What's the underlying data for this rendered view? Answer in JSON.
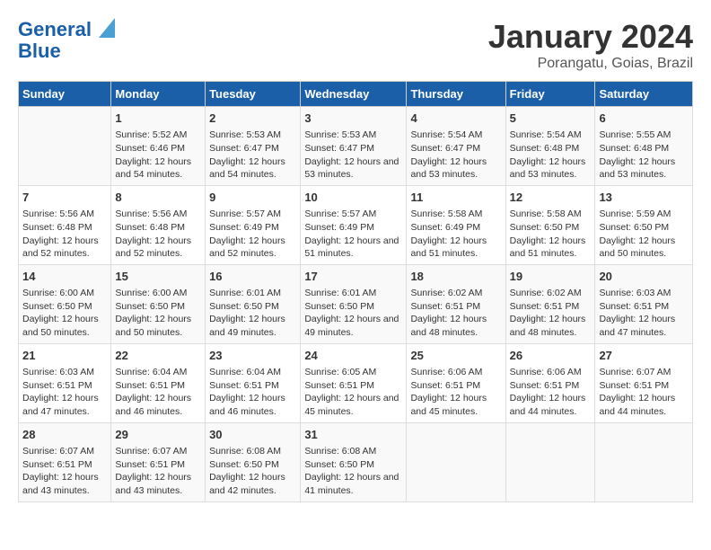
{
  "header": {
    "logo_line1": "General",
    "logo_line2": "Blue",
    "title": "January 2024",
    "subtitle": "Porangatu, Goias, Brazil"
  },
  "weekdays": [
    "Sunday",
    "Monday",
    "Tuesday",
    "Wednesday",
    "Thursday",
    "Friday",
    "Saturday"
  ],
  "weeks": [
    [
      {
        "day": "",
        "sunrise": "",
        "sunset": "",
        "daylight": ""
      },
      {
        "day": "1",
        "sunrise": "Sunrise: 5:52 AM",
        "sunset": "Sunset: 6:46 PM",
        "daylight": "Daylight: 12 hours and 54 minutes."
      },
      {
        "day": "2",
        "sunrise": "Sunrise: 5:53 AM",
        "sunset": "Sunset: 6:47 PM",
        "daylight": "Daylight: 12 hours and 54 minutes."
      },
      {
        "day": "3",
        "sunrise": "Sunrise: 5:53 AM",
        "sunset": "Sunset: 6:47 PM",
        "daylight": "Daylight: 12 hours and 53 minutes."
      },
      {
        "day": "4",
        "sunrise": "Sunrise: 5:54 AM",
        "sunset": "Sunset: 6:47 PM",
        "daylight": "Daylight: 12 hours and 53 minutes."
      },
      {
        "day": "5",
        "sunrise": "Sunrise: 5:54 AM",
        "sunset": "Sunset: 6:48 PM",
        "daylight": "Daylight: 12 hours and 53 minutes."
      },
      {
        "day": "6",
        "sunrise": "Sunrise: 5:55 AM",
        "sunset": "Sunset: 6:48 PM",
        "daylight": "Daylight: 12 hours and 53 minutes."
      }
    ],
    [
      {
        "day": "7",
        "sunrise": "Sunrise: 5:56 AM",
        "sunset": "Sunset: 6:48 PM",
        "daylight": "Daylight: 12 hours and 52 minutes."
      },
      {
        "day": "8",
        "sunrise": "Sunrise: 5:56 AM",
        "sunset": "Sunset: 6:48 PM",
        "daylight": "Daylight: 12 hours and 52 minutes."
      },
      {
        "day": "9",
        "sunrise": "Sunrise: 5:57 AM",
        "sunset": "Sunset: 6:49 PM",
        "daylight": "Daylight: 12 hours and 52 minutes."
      },
      {
        "day": "10",
        "sunrise": "Sunrise: 5:57 AM",
        "sunset": "Sunset: 6:49 PM",
        "daylight": "Daylight: 12 hours and 51 minutes."
      },
      {
        "day": "11",
        "sunrise": "Sunrise: 5:58 AM",
        "sunset": "Sunset: 6:49 PM",
        "daylight": "Daylight: 12 hours and 51 minutes."
      },
      {
        "day": "12",
        "sunrise": "Sunrise: 5:58 AM",
        "sunset": "Sunset: 6:50 PM",
        "daylight": "Daylight: 12 hours and 51 minutes."
      },
      {
        "day": "13",
        "sunrise": "Sunrise: 5:59 AM",
        "sunset": "Sunset: 6:50 PM",
        "daylight": "Daylight: 12 hours and 50 minutes."
      }
    ],
    [
      {
        "day": "14",
        "sunrise": "Sunrise: 6:00 AM",
        "sunset": "Sunset: 6:50 PM",
        "daylight": "Daylight: 12 hours and 50 minutes."
      },
      {
        "day": "15",
        "sunrise": "Sunrise: 6:00 AM",
        "sunset": "Sunset: 6:50 PM",
        "daylight": "Daylight: 12 hours and 50 minutes."
      },
      {
        "day": "16",
        "sunrise": "Sunrise: 6:01 AM",
        "sunset": "Sunset: 6:50 PM",
        "daylight": "Daylight: 12 hours and 49 minutes."
      },
      {
        "day": "17",
        "sunrise": "Sunrise: 6:01 AM",
        "sunset": "Sunset: 6:50 PM",
        "daylight": "Daylight: 12 hours and 49 minutes."
      },
      {
        "day": "18",
        "sunrise": "Sunrise: 6:02 AM",
        "sunset": "Sunset: 6:51 PM",
        "daylight": "Daylight: 12 hours and 48 minutes."
      },
      {
        "day": "19",
        "sunrise": "Sunrise: 6:02 AM",
        "sunset": "Sunset: 6:51 PM",
        "daylight": "Daylight: 12 hours and 48 minutes."
      },
      {
        "day": "20",
        "sunrise": "Sunrise: 6:03 AM",
        "sunset": "Sunset: 6:51 PM",
        "daylight": "Daylight: 12 hours and 47 minutes."
      }
    ],
    [
      {
        "day": "21",
        "sunrise": "Sunrise: 6:03 AM",
        "sunset": "Sunset: 6:51 PM",
        "daylight": "Daylight: 12 hours and 47 minutes."
      },
      {
        "day": "22",
        "sunrise": "Sunrise: 6:04 AM",
        "sunset": "Sunset: 6:51 PM",
        "daylight": "Daylight: 12 hours and 46 minutes."
      },
      {
        "day": "23",
        "sunrise": "Sunrise: 6:04 AM",
        "sunset": "Sunset: 6:51 PM",
        "daylight": "Daylight: 12 hours and 46 minutes."
      },
      {
        "day": "24",
        "sunrise": "Sunrise: 6:05 AM",
        "sunset": "Sunset: 6:51 PM",
        "daylight": "Daylight: 12 hours and 45 minutes."
      },
      {
        "day": "25",
        "sunrise": "Sunrise: 6:06 AM",
        "sunset": "Sunset: 6:51 PM",
        "daylight": "Daylight: 12 hours and 45 minutes."
      },
      {
        "day": "26",
        "sunrise": "Sunrise: 6:06 AM",
        "sunset": "Sunset: 6:51 PM",
        "daylight": "Daylight: 12 hours and 44 minutes."
      },
      {
        "day": "27",
        "sunrise": "Sunrise: 6:07 AM",
        "sunset": "Sunset: 6:51 PM",
        "daylight": "Daylight: 12 hours and 44 minutes."
      }
    ],
    [
      {
        "day": "28",
        "sunrise": "Sunrise: 6:07 AM",
        "sunset": "Sunset: 6:51 PM",
        "daylight": "Daylight: 12 hours and 43 minutes."
      },
      {
        "day": "29",
        "sunrise": "Sunrise: 6:07 AM",
        "sunset": "Sunset: 6:51 PM",
        "daylight": "Daylight: 12 hours and 43 minutes."
      },
      {
        "day": "30",
        "sunrise": "Sunrise: 6:08 AM",
        "sunset": "Sunset: 6:50 PM",
        "daylight": "Daylight: 12 hours and 42 minutes."
      },
      {
        "day": "31",
        "sunrise": "Sunrise: 6:08 AM",
        "sunset": "Sunset: 6:50 PM",
        "daylight": "Daylight: 12 hours and 41 minutes."
      },
      {
        "day": "",
        "sunrise": "",
        "sunset": "",
        "daylight": ""
      },
      {
        "day": "",
        "sunrise": "",
        "sunset": "",
        "daylight": ""
      },
      {
        "day": "",
        "sunrise": "",
        "sunset": "",
        "daylight": ""
      }
    ]
  ]
}
